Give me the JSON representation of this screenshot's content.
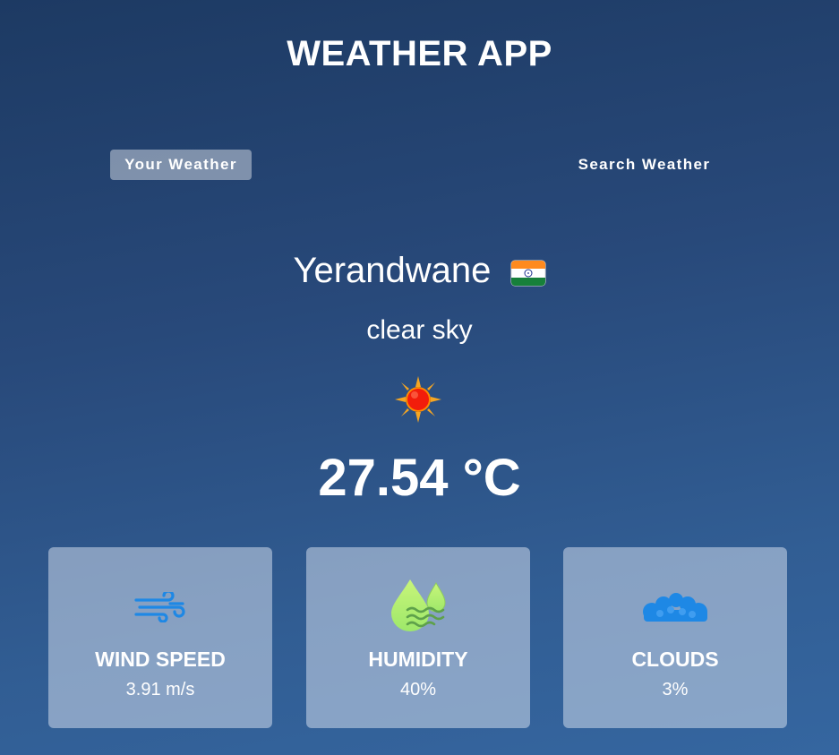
{
  "app": {
    "title": "WEATHER APP"
  },
  "tabs": {
    "your_weather": "Your Weather",
    "search_weather": "Search Weather"
  },
  "location": {
    "city": "Yerandwane",
    "country_flag": "india-flag-icon"
  },
  "weather": {
    "description": "clear sky",
    "icon": "sun-icon",
    "temperature": "27.54 °C"
  },
  "cards": {
    "wind": {
      "label": "WIND SPEED",
      "value": "3.91 m/s",
      "icon": "wind-icon"
    },
    "humidity": {
      "label": "HUMIDITY",
      "value": "40%",
      "icon": "humidity-icon"
    },
    "clouds": {
      "label": "CLOUDS",
      "value": "3%",
      "icon": "cloud-icon"
    }
  },
  "colors": {
    "accent_blue": "#1e88e5",
    "humidity_green": "#b2f06a"
  }
}
